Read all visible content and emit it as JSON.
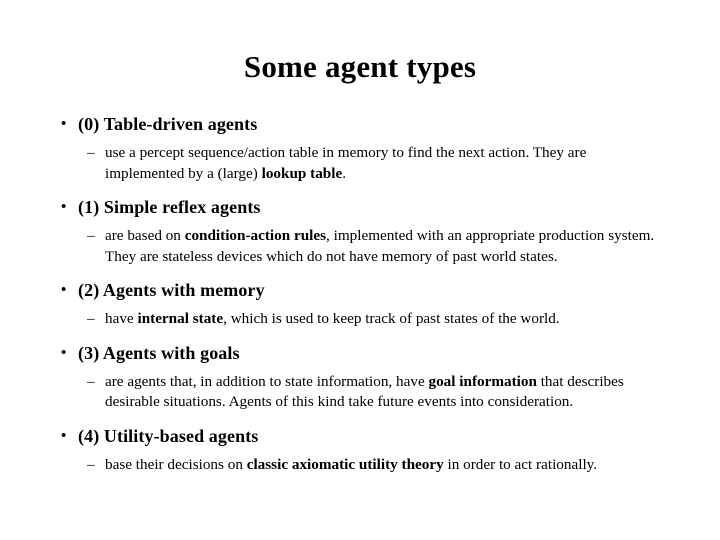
{
  "slide": {
    "title": "Some agent types",
    "bullet_glyph": "•",
    "dash_glyph": "–",
    "text_color": "#000000",
    "background_color": "#ffffff",
    "items": [
      {
        "heading": "(0) Table-driven agents",
        "detail_parts": [
          {
            "text": "use a percept sequence/action table in memory to find the next action. They are implemented by a (large) ",
            "bold": false
          },
          {
            "text": "lookup table",
            "bold": true
          },
          {
            "text": ".",
            "bold": false
          }
        ]
      },
      {
        "heading": "(1) Simple reflex agents",
        "detail_parts": [
          {
            "text": "are based on ",
            "bold": false
          },
          {
            "text": "condition-action rules",
            "bold": true
          },
          {
            "text": ", implemented with an appropriate production system. They are stateless devices which do not have memory of past world states.",
            "bold": false
          }
        ]
      },
      {
        "heading": "(2) Agents with memory",
        "detail_parts": [
          {
            "text": "have ",
            "bold": false
          },
          {
            "text": "internal state",
            "bold": true
          },
          {
            "text": ", which is used to keep track of past states of the world.",
            "bold": false
          }
        ]
      },
      {
        "heading": "(3) Agents with goals",
        "detail_parts": [
          {
            "text": "are agents that, in addition to state information, have ",
            "bold": false
          },
          {
            "text": "goal information",
            "bold": true
          },
          {
            "text": " that describes desirable situations. Agents of this kind take future events into consideration.",
            "bold": false
          }
        ]
      },
      {
        "heading": "(4) Utility-based agents",
        "detail_parts": [
          {
            "text": "base their decisions on ",
            "bold": false
          },
          {
            "text": "classic axiomatic utility theory",
            "bold": true
          },
          {
            "text": " in order to act rationally.",
            "bold": false
          }
        ]
      }
    ]
  }
}
